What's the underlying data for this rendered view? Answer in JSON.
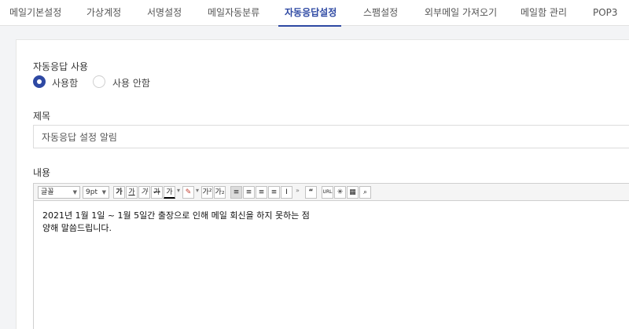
{
  "tabs": [
    {
      "label": "메일기본설정",
      "active": false
    },
    {
      "label": "가상계정",
      "active": false
    },
    {
      "label": "서명설정",
      "active": false
    },
    {
      "label": "메일자동분류",
      "active": false
    },
    {
      "label": "자동응답설정",
      "active": true
    },
    {
      "label": "스팸설정",
      "active": false
    },
    {
      "label": "외부메일 가져오기",
      "active": false
    },
    {
      "label": "메일함 관리",
      "active": false
    },
    {
      "label": "POP3",
      "active": false
    }
  ],
  "form": {
    "autoreply_label": "자동응답 사용",
    "use_on_label": "사용함",
    "use_off_label": "사용 안함",
    "selected": "use",
    "subject_label": "제목",
    "subject_value": "자동응답 설정 알림",
    "content_label": "내용"
  },
  "editor": {
    "font_select": "글꼴",
    "size_select": "9pt",
    "body_lines": [
      "2021년 1월 1일 ~ 1월 5일간 출장으로 인해 메일 회신을 하지 못하는 점",
      "양해 말씀드립니다."
    ]
  },
  "colors": {
    "accent": "#2e49a3"
  }
}
